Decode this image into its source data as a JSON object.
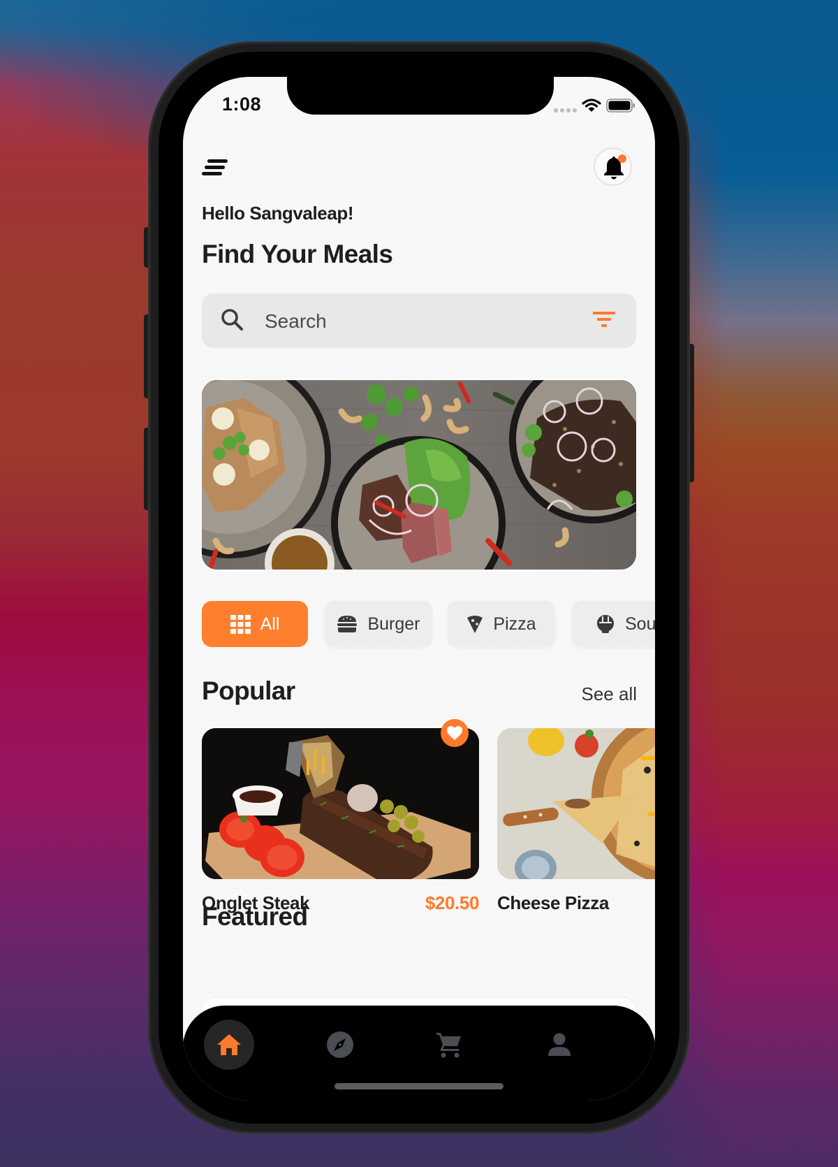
{
  "status_bar": {
    "time": "1:08",
    "icons": [
      "signal-dots-icon",
      "wifi-icon",
      "battery-icon"
    ]
  },
  "header": {
    "menu_icon": "menu-icon",
    "notification_icon": "bell-icon",
    "notification_badge": true,
    "greeting": "Hello Sangvaleap!",
    "title": "Find Your Meals"
  },
  "search": {
    "placeholder": "Search",
    "value": "",
    "leading_icon": "search-icon",
    "trailing_icon": "filter-icon"
  },
  "banner": {
    "image": "food-spread-banner"
  },
  "categories": [
    {
      "label": "All",
      "icon": "grid-icon",
      "active": true
    },
    {
      "label": "Burger",
      "icon": "burger-icon",
      "active": false
    },
    {
      "label": "Pizza",
      "icon": "pizza-icon",
      "active": false
    },
    {
      "label": "Sou",
      "icon": "soup-icon",
      "active": false
    }
  ],
  "popular": {
    "title": "Popular",
    "see_all": "See all",
    "items": [
      {
        "name": "Onglet Steak",
        "price": "$20.50",
        "favorite": true,
        "image": "ribs-steak-photo"
      },
      {
        "name": "Cheese Pizza",
        "price": "",
        "favorite": false,
        "image": "cheese-pizza-photo"
      }
    ]
  },
  "featured": {
    "title": "Featured"
  },
  "tab_bar": {
    "items": [
      {
        "name": "home",
        "icon": "home-icon",
        "active": true
      },
      {
        "name": "explore",
        "icon": "compass-icon",
        "active": false
      },
      {
        "name": "cart",
        "icon": "cart-icon",
        "active": false
      },
      {
        "name": "profile",
        "icon": "person-icon",
        "active": false
      }
    ]
  },
  "colors": {
    "accent": "#ff7a2b",
    "text_primary": "#1e1e1e",
    "search_bg": "#e8e8e8",
    "tab_bar_bg": "#000000",
    "tab_icon_inactive": "#4a4d52"
  }
}
